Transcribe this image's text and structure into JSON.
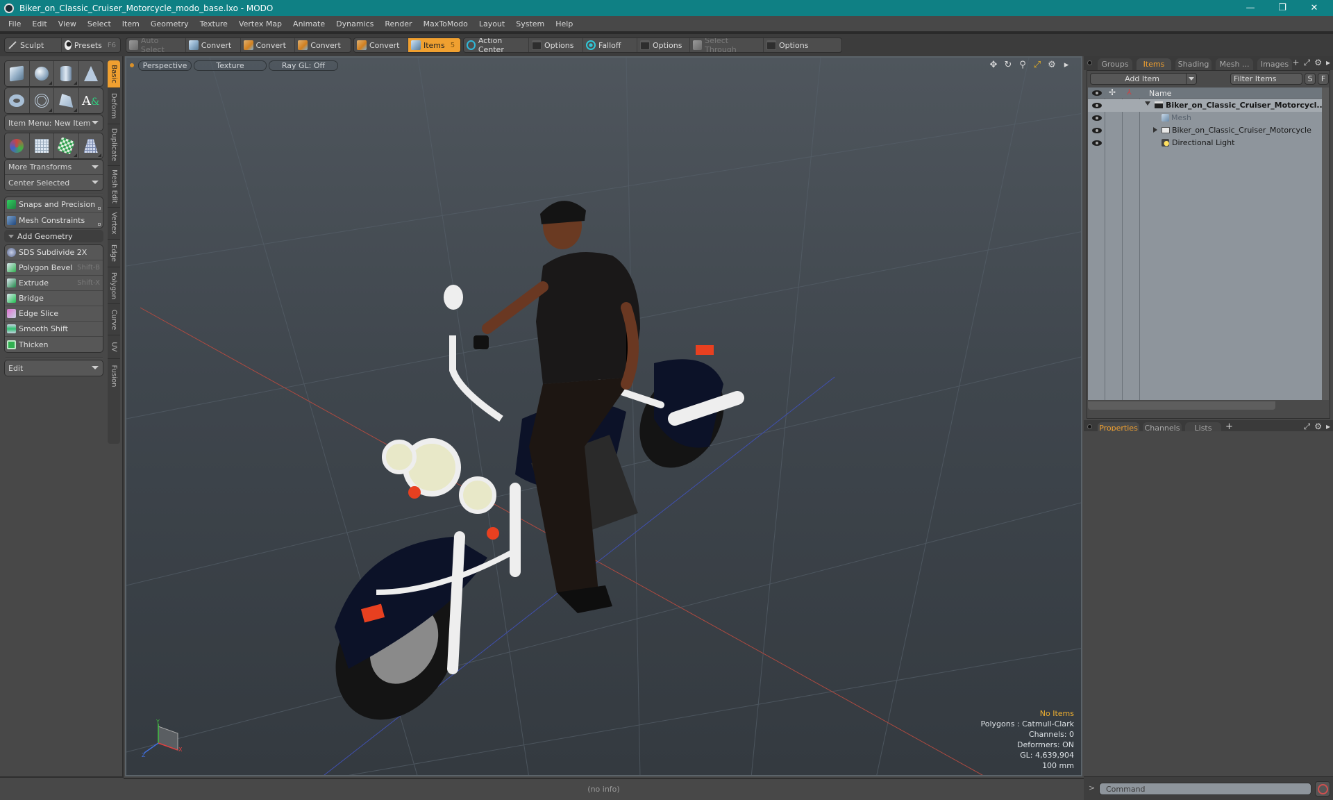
{
  "window": {
    "title": "Biker_on_Classic_Cruiser_Motorcycle_modo_base.lxo - MODO",
    "controls": {
      "minimize": "—",
      "restore": "❐",
      "close": "✕"
    }
  },
  "menubar": [
    "File",
    "Edit",
    "View",
    "Select",
    "Item",
    "Geometry",
    "Texture",
    "Vertex Map",
    "Animate",
    "Dynamics",
    "Render",
    "MaxToModo",
    "Layout",
    "System",
    "Help"
  ],
  "toolbar": {
    "sculpt": "Sculpt",
    "presets": "Presets",
    "presets_hotkey": "F6",
    "auto_select": "Auto Select",
    "convert_1": "Convert",
    "convert_2": "Convert",
    "convert_3": "Convert",
    "convert_4": "Convert",
    "items": "Items",
    "items_hotkey": "5",
    "action_center": "Action Center",
    "options_1": "Options",
    "falloff": "Falloff",
    "options_2": "Options",
    "select_through": "Select Through",
    "options_3": "Options"
  },
  "left_panel": {
    "item_menu": "Item Menu: New Item",
    "more_transforms": "More Transforms",
    "center_selected": "Center Selected",
    "snaps": "Snaps and Precision",
    "mesh_constraints": "Mesh Constraints",
    "add_geometry": "Add Geometry",
    "tools": [
      {
        "label": "SDS Subdivide 2X",
        "hotkey": ""
      },
      {
        "label": "Polygon Bevel",
        "hotkey": "Shift-B"
      },
      {
        "label": "Extrude",
        "hotkey": "Shift-X"
      },
      {
        "label": "Bridge",
        "hotkey": ""
      },
      {
        "label": "Edge Slice",
        "hotkey": ""
      },
      {
        "label": "Smooth Shift",
        "hotkey": ""
      },
      {
        "label": "Thicken",
        "hotkey": ""
      }
    ],
    "edit_dropdown": "Edit",
    "vertical_tabs": [
      "Basic",
      "Deform",
      "Duplicate",
      "Mesh Edit",
      "Vertex",
      "Edge",
      "Polygon",
      "Curve",
      "UV",
      "Fusion"
    ],
    "active_vertical_tab": "Basic"
  },
  "viewport": {
    "view_mode": "Perspective",
    "shading": "Texture",
    "raygl": "Ray GL: Off",
    "info": {
      "selection": "No Items",
      "polygons": "Polygons : Catmull-Clark",
      "channels": "Channels: 0",
      "deformers": "Deformers: ON",
      "gl": "GL: 4,639,904",
      "unit": "100 mm"
    },
    "axis_labels": {
      "x": "X",
      "y": "Y",
      "z": "Z"
    }
  },
  "right_panel": {
    "top_tabs": [
      "Groups",
      "Items",
      "Shading",
      "Mesh ...",
      "Images"
    ],
    "active_top_tab": "Items",
    "add_item": "Add Item",
    "filter_items": "Filter Items",
    "s_button": "S",
    "f_button": "F",
    "name_column": "Name",
    "items": [
      {
        "name": "Biker_on_Classic_Cruiser_Motorcycl...",
        "type": "scene",
        "bold": true,
        "dim": false,
        "expanded": true
      },
      {
        "name": "Mesh",
        "type": "mesh",
        "bold": false,
        "dim": true,
        "expanded": false
      },
      {
        "name": "Biker_on_Classic_Cruiser_Motorcycle",
        "type": "group",
        "bold": false,
        "dim": false,
        "expanded": false
      },
      {
        "name": "Directional Light",
        "type": "light",
        "bold": false,
        "dim": false,
        "expanded": false
      }
    ],
    "bottom_tabs": [
      "Properties",
      "Channels",
      "Lists"
    ],
    "active_bottom_tab": "Properties",
    "command_placeholder": "Command",
    "command_prompt": ">"
  },
  "statusbar": {
    "text": "(no info)"
  },
  "colors": {
    "accent": "#f0a030",
    "titlebar": "#0f8084"
  }
}
